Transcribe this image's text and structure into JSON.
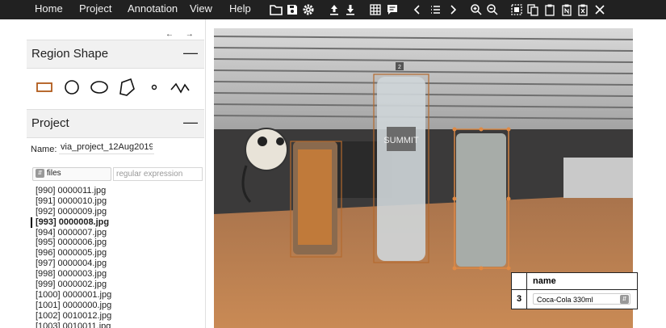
{
  "menu": {
    "home": "Home",
    "project": "Project",
    "annotation": "Annotation",
    "view": "View",
    "help": "Help"
  },
  "toolbar_icons": [
    "folder-icon",
    "save-icon",
    "gear-icon",
    "upload-icon",
    "download-icon",
    "grid-icon",
    "comment-icon",
    "prev-icon",
    "list-icon",
    "next-icon",
    "zoom-in-icon",
    "zoom-out-icon",
    "select-all-icon",
    "copy-icon",
    "paste-icon",
    "paste-n-icon",
    "delete-icon",
    "close-icon"
  ],
  "sidebar": {
    "nav_arrows": "← → ‹",
    "region_shape": {
      "title": "Region Shape",
      "toggle": "—"
    },
    "shape_icons": [
      "rectangle-icon",
      "circle-icon",
      "ellipse-icon",
      "polygon-icon",
      "point-icon",
      "polyline-icon"
    ],
    "project": {
      "title": "Project",
      "toggle": "—",
      "name_label": "Name:",
      "name_value": "via_project_12Aug2019_9",
      "filter_selected": "All files",
      "regex_placeholder": "regular expression",
      "files": [
        "[990] 0000011.jpg",
        "[991] 0000010.jpg",
        "[992] 0000009.jpg",
        "[993] 0000008.jpg",
        "[994] 0000007.jpg",
        "[995] 0000006.jpg",
        "[996] 0000005.jpg",
        "[997] 0000004.jpg",
        "[998] 0000003.jpg",
        "[999] 0000002.jpg",
        "[1000] 0000001.jpg",
        "[1001] 0000000.jpg",
        "[1002] 0010012.jpg",
        "[1003] 0010011.jpg"
      ],
      "active_file": "[993] 0000008.jpg"
    }
  },
  "canvas": {
    "region_labels": [
      "2",
      "3"
    ],
    "bottle_text": "SUMMIT"
  },
  "attributes": {
    "header": "name",
    "row_id": "3",
    "row_value": "Coca-Cola 330ml"
  },
  "colors": {
    "topbar": "#212121",
    "region_box": "#c8783a",
    "table_tint": "#c07a42"
  }
}
